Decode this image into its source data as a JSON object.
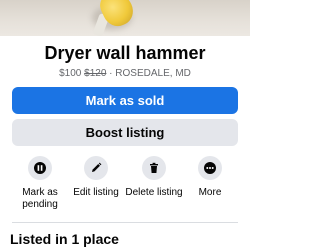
{
  "listing": {
    "title": "Dryer wall hammer",
    "price": "$100",
    "original_price": "$120",
    "separator": " · ",
    "location": "ROSEDALE, MD"
  },
  "buttons": {
    "mark_sold": "Mark as sold",
    "boost": "Boost listing"
  },
  "actions": [
    {
      "label": "Mark as pending",
      "icon": "pause-icon"
    },
    {
      "label": "Edit listing",
      "icon": "pencil-icon"
    },
    {
      "label": "Delete listing",
      "icon": "trash-icon"
    },
    {
      "label": "More",
      "icon": "more-icon"
    }
  ],
  "section": {
    "title": "Listed in 1 place"
  },
  "colors": {
    "primary": "#1b74e4",
    "secondary_bg": "#e4e6eb",
    "muted_text": "#65676b"
  }
}
